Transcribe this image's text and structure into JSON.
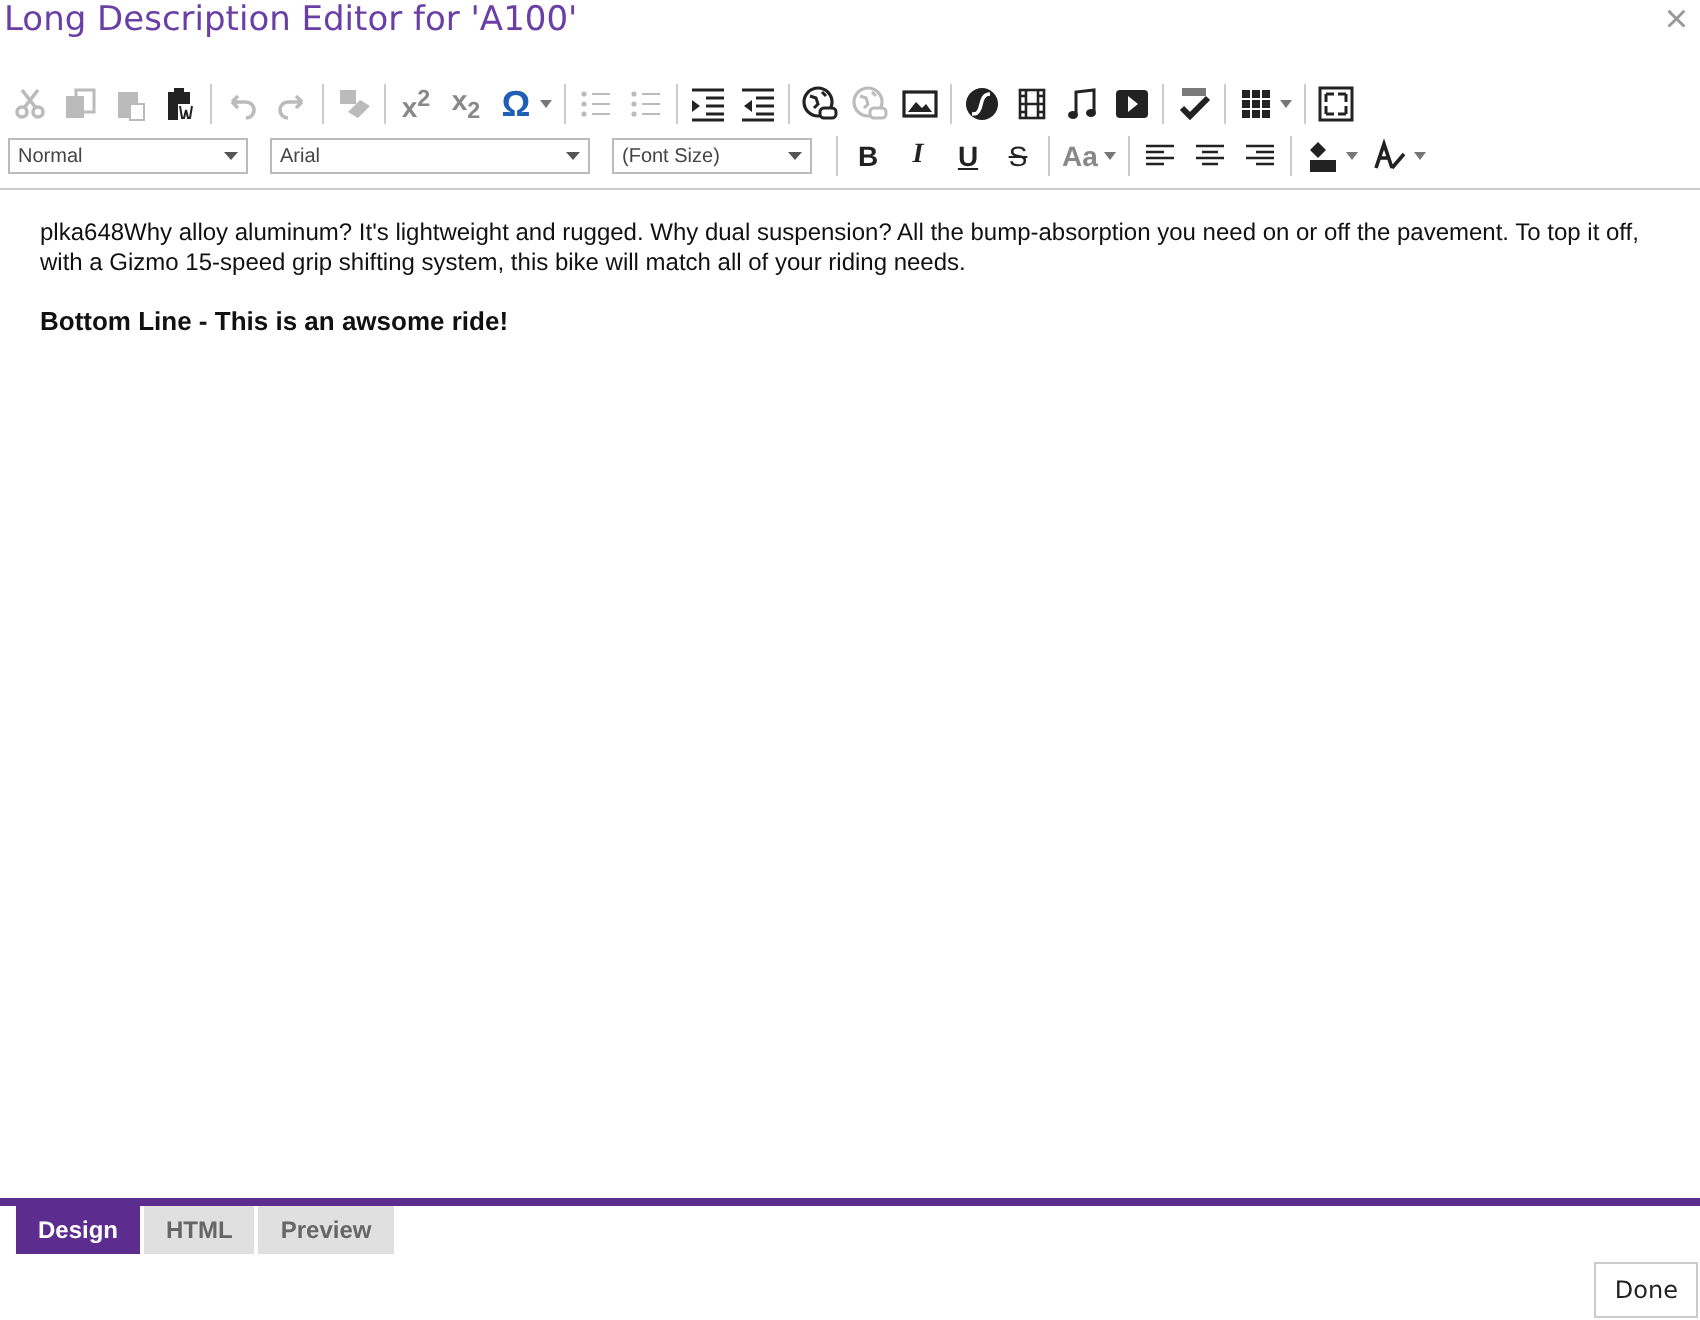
{
  "window": {
    "title": "Long Description Editor for 'A100'",
    "close": "×"
  },
  "toolbar": [
    [
      [
        {
          "kind": "cut",
          "disabled": true
        },
        {
          "kind": "copy",
          "disabled": true
        },
        {
          "kind": "paste",
          "disabled": true
        },
        {
          "kind": "paste-word",
          "disabled": false
        }
      ],
      [
        {
          "kind": "undo",
          "disabled": true
        },
        {
          "kind": "redo",
          "disabled": true
        }
      ],
      [
        {
          "kind": "eraser",
          "disabled": true
        }
      ],
      [
        {
          "kind": "superscript",
          "label": "x$^{2}$",
          "disabled": false
        },
        {
          "kind": "subscript",
          "label": "x$_{2}$",
          "disabled": false
        },
        {
          "kind": "omega",
          "label": "Ω",
          "disabled": false,
          "dropdown": true
        }
      ],
      [
        {
          "kind": "ordered-list",
          "disabled": true
        },
        {
          "kind": "bullet-list",
          "disabled": true
        }
      ],
      [
        {
          "kind": "indent",
          "disabled": false
        },
        {
          "kind": "outdent",
          "disabled": false
        }
      ],
      [
        {
          "kind": "globe-link",
          "disabled": false
        },
        {
          "kind": "globe-unlink",
          "disabled": true
        },
        {
          "kind": "image",
          "disabled": false
        }
      ],
      [
        {
          "kind": "flash",
          "disabled": false
        },
        {
          "kind": "film",
          "disabled": false
        },
        {
          "kind": "music",
          "disabled": false
        },
        {
          "kind": "play",
          "disabled": false
        }
      ],
      [
        {
          "kind": "spellcheck",
          "disabled": false
        }
      ],
      [
        {
          "kind": "table",
          "disabled": false,
          "dropdown": true
        }
      ],
      [
        {
          "kind": "fullscreen",
          "disabled": false
        }
      ]
    ],
    [
      [
        {
          "kind": "select",
          "label": "Normal"
        },
        {
          "kind": "select",
          "label": "Arial"
        },
        {
          "kind": "select",
          "label": "(Font Size)"
        }
      ],
      [
        {
          "kind": "bold",
          "label": "B",
          "disabled": false
        },
        {
          "kind": "italic",
          "label": "I",
          "disabled": false
        },
        {
          "kind": "underline",
          "label": "U",
          "disabled": false
        },
        {
          "kind": "strike",
          "label": "S",
          "disabled": false
        }
      ],
      [
        {
          "kind": "case",
          "label": "Aa",
          "disabled": false,
          "dropdown": true
        }
      ],
      [
        {
          "kind": "align-left",
          "disabled": false
        },
        {
          "kind": "align-center",
          "disabled": false
        },
        {
          "kind": "align-right",
          "disabled": false
        }
      ],
      [
        {
          "kind": "fill-color",
          "disabled": false,
          "dropdown": true
        },
        {
          "kind": "format-painter",
          "disabled": false,
          "dropdown": true
        }
      ]
    ]
  ],
  "content": {
    "paragraph": "plka648Why alloy aluminum? It's lightweight and rugged. Why dual suspension? All the bump-absorption you need on or off the pavement. To top it off, with a Gizmo 15-speed grip shifting system, this bike will match all of your riding needs.",
    "heading": "Bottom Line - This is an awsome ride!"
  },
  "tabs": [
    {
      "label": "Design",
      "selected": true
    },
    {
      "label": "HTML",
      "selected": false
    },
    {
      "label": "Preview",
      "selected": false
    }
  ],
  "buttons": [
    "Done"
  ]
}
